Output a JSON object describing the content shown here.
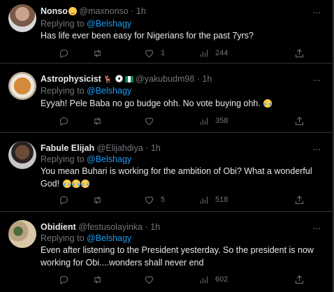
{
  "tweets": [
    {
      "name": "Nonso",
      "name_emoji": "winking-face",
      "handle": "@maxnonso",
      "time": "· 1h",
      "reply_prefix": "Replying to",
      "reply_to": "@Belshagy",
      "text": "Has life ever been easy for Nigerians for the past 7yrs?",
      "replies": "",
      "retweets": "",
      "likes": "1",
      "views": "244"
    },
    {
      "name": "Astrophysicist",
      "name_emoji": "deer, soccer-ball, nigeria-flag",
      "handle": "@yakubudm98",
      "time": "· 1h",
      "reply_prefix": "Replying to",
      "reply_to": "@Belshagy",
      "text": "Eyyah! Pele Baba no go budge ohh. No vote buying ohh.",
      "text_emoji": [
        "face-with-tears-of-joy"
      ],
      "replies": "",
      "retweets": "",
      "likes": "",
      "views": "358"
    },
    {
      "name": "Fabule Elijah",
      "handle": "@Elijahdiya",
      "time": "· 1h",
      "reply_prefix": "Replying to",
      "reply_to": "@Belshagy",
      "text_line1": "You mean Buhari is working for the ambition of Obi? What a wonderful",
      "text_line2": "God!",
      "text_emoji": [
        "face-with-tears-of-joy",
        "face-with-tears-of-joy",
        "face-with-tears-of-joy"
      ],
      "replies": "",
      "retweets": "",
      "likes": "5",
      "views": "518"
    },
    {
      "name": "Obidient",
      "handle": "@festusolayinka",
      "time": "· 1h",
      "reply_prefix": "Replying to",
      "reply_to": "@Belshagy",
      "text_line1": "Even after listening to the President yesterday. So the president is now",
      "text_line2": "working for Obi....wonders shall never end",
      "replies": "",
      "retweets": "",
      "likes": "",
      "views": "602"
    }
  ],
  "colors": {
    "background": "#000000",
    "text": "#e7e9ea",
    "muted": "#71767b",
    "link": "#1d9bf0",
    "divider": "#2f3336"
  },
  "icons": [
    "more-icon",
    "reply-icon",
    "retweet-icon",
    "like-icon",
    "views-icon",
    "share-icon"
  ]
}
